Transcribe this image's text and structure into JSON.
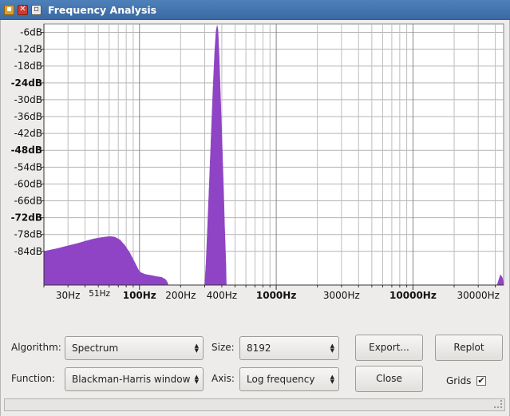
{
  "window": {
    "title": "Frequency Analysis",
    "lock_icon": "lock-icon",
    "close_icon": "close-icon",
    "maximize_icon": "maximize-icon"
  },
  "chart_data": {
    "type": "area",
    "x_scale": "log",
    "y_ticks": [
      "-6dB",
      "-12dB",
      "-18dB",
      "-24dB",
      "-30dB",
      "-36dB",
      "-42dB",
      "-48dB",
      "-54dB",
      "-60dB",
      "-66dB",
      "-72dB",
      "-78dB",
      "-84dB"
    ],
    "y_ticks_bold": [
      "-24dB",
      "-48dB",
      "-72dB"
    ],
    "x_ticks": [
      "30Hz",
      "51Hz",
      "100Hz",
      "200Hz",
      "400Hz",
      "1000Hz",
      "3000Hz",
      "10000Hz",
      "30000Hz"
    ],
    "x_ticks_bold": [
      "100Hz",
      "1000Hz",
      "10000Hz"
    ],
    "grid": true,
    "fill_color": "#8e44c4",
    "spectrum": [
      [
        20,
        -84
      ],
      [
        25,
        -83
      ],
      [
        30,
        -82
      ],
      [
        35,
        -81.2
      ],
      [
        40,
        -80.4
      ],
      [
        46,
        -79.6
      ],
      [
        52,
        -79.1
      ],
      [
        58,
        -78.8
      ],
      [
        62,
        -78.7
      ],
      [
        66,
        -78.9
      ],
      [
        72,
        -79.9
      ],
      [
        78,
        -81.8
      ],
      [
        85,
        -84.6
      ],
      [
        92,
        -87.8
      ],
      [
        98,
        -90.5
      ],
      [
        102,
        -91.5
      ],
      [
        110,
        -92.2
      ],
      [
        122,
        -92.6
      ],
      [
        135,
        -93
      ],
      [
        145,
        -93.2
      ],
      [
        155,
        -94
      ],
      [
        160,
        -95
      ],
      [
        162,
        -97
      ]
    ],
    "peak": [
      [
        300,
        -97
      ],
      [
        307,
        -88
      ],
      [
        315,
        -75
      ],
      [
        325,
        -58
      ],
      [
        335,
        -42
      ],
      [
        345,
        -26
      ],
      [
        355,
        -13
      ],
      [
        363,
        -5.5
      ],
      [
        370,
        -3.5
      ],
      [
        375,
        -5
      ],
      [
        382,
        -14
      ],
      [
        392,
        -30
      ],
      [
        402,
        -46
      ],
      [
        412,
        -62
      ],
      [
        420,
        -76
      ],
      [
        428,
        -88
      ],
      [
        432,
        -97
      ]
    ],
    "tail": [
      [
        41200,
        -97
      ],
      [
        42500,
        -94
      ],
      [
        43600,
        -92.3
      ],
      [
        45200,
        -93.5
      ],
      [
        46000,
        -97
      ]
    ]
  },
  "controls": {
    "algorithm_label": "Algorithm:",
    "algorithm_value": "Spectrum",
    "size_label": "Size:",
    "size_value": "8192",
    "function_label": "Function:",
    "function_value": "Blackman-Harris window",
    "axis_label": "Axis:",
    "axis_value": "Log frequency",
    "export_label": "Export...",
    "replot_label": "Replot",
    "close_label": "Close",
    "grids_label": "Grids",
    "grids_checked": "✔"
  }
}
